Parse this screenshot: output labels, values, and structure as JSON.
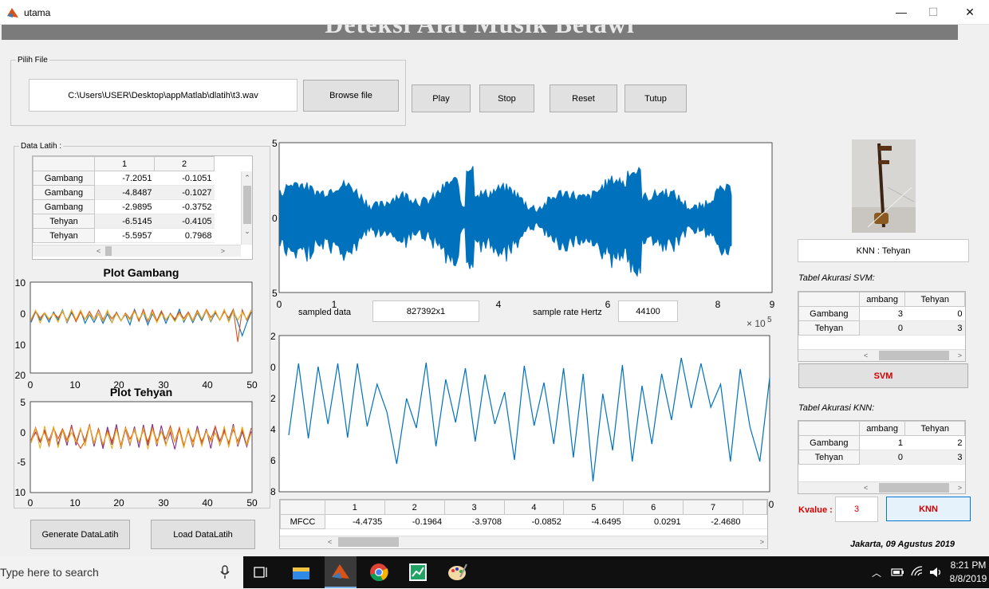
{
  "window": {
    "title": "utama",
    "minimize": "—",
    "maximize": "☐",
    "close": "✕"
  },
  "banner": {
    "text": "Deteksi Alat Musik Betawi"
  },
  "file_panel": {
    "legend": "Pilih File",
    "path": "C:\\Users\\USER\\Desktop\\appMatlab\\dlatih\\t3.wav",
    "browse": "Browse file"
  },
  "controls": {
    "play": "Play",
    "stop": "Stop",
    "reset": "Reset",
    "tutup": "Tutup"
  },
  "data_latih": {
    "legend": "Data Latih :",
    "columns": [
      "1",
      "2"
    ],
    "rows": [
      [
        "Gambang",
        "-7.2051",
        "-0.1051"
      ],
      [
        "Gambang",
        "-4.8487",
        "-0.1027"
      ],
      [
        "Gambang",
        "-2.9895",
        "-0.3752"
      ],
      [
        "Tehyan",
        "-6.5145",
        "-0.4105"
      ],
      [
        "Tehyan",
        "-5.5957",
        "0.7968"
      ]
    ]
  },
  "plot_gambang": {
    "title": "Plot Gambang",
    "yticks": [
      "10",
      "0",
      "10",
      "20"
    ],
    "xticks": [
      "0",
      "10",
      "20",
      "30",
      "40",
      "50"
    ]
  },
  "plot_tehyan": {
    "title": "Plot Tehyan",
    "yticks": [
      "5",
      "0",
      "-5",
      "10"
    ],
    "xticks": [
      "0",
      "10",
      "20",
      "30",
      "40",
      "50"
    ]
  },
  "waveform": {
    "xticks": [
      "0",
      "1",
      "4",
      "6",
      "8",
      "9"
    ],
    "exponent": "× 10",
    "exponent_power": "5",
    "ytick_top": "5",
    "ytick_mid": "0",
    "ytick_bot": "5"
  },
  "sampled": {
    "label": "sampled data",
    "value": "827392x1",
    "rate_label": "sample rate Hertz",
    "rate_value": "44100"
  },
  "mfcc_plot": {
    "yticks": [
      "2",
      "0",
      "2",
      "4",
      "6",
      "8"
    ],
    "xtick_end": "50"
  },
  "mfcc_table": {
    "row_label": "MFCC",
    "columns": [
      "1",
      "2",
      "3",
      "4",
      "5",
      "6",
      "7"
    ],
    "values": [
      "-4.4735",
      "-0.1964",
      "-3.9708",
      "-0.0852",
      "-4.6495",
      "0.0291",
      "-2.4680"
    ]
  },
  "result": {
    "knn_text": "KNN : Tehyan"
  },
  "svm_table": {
    "title": "Tabel Akurasi SVM:",
    "columns": [
      "ambang",
      "Tehyan"
    ],
    "rows": [
      [
        "Gambang",
        "3",
        "0"
      ],
      [
        "Tehyan",
        "0",
        "3"
      ]
    ],
    "button": "SVM"
  },
  "knn_table": {
    "title": "Tabel Akurasi KNN:",
    "columns": [
      "ambang",
      "Tehyan"
    ],
    "rows": [
      [
        "Gambang",
        "1",
        "2"
      ],
      [
        "Tehyan",
        "0",
        "3"
      ]
    ],
    "button": "KNN"
  },
  "kvalue": {
    "label": "Kvalue :",
    "value": "3"
  },
  "footer": {
    "date": "Jakarta, 09 Agustus 2019"
  },
  "buttons": {
    "generate": "Generate DataLatih",
    "load": "Load DataLatih"
  },
  "taskbar": {
    "search_placeholder": "Type here to search",
    "time": "8:21 PM",
    "date": "8/8/2019"
  },
  "colors": {
    "accent_red": "#d40000",
    "series_blue": "#0072bd",
    "series_orange": "#d95319",
    "series_yellow": "#edb120",
    "series_purple": "#7e2f8e",
    "knn_button_bg": "#e5f1fb",
    "knn_button_border": "#0078d7"
  }
}
